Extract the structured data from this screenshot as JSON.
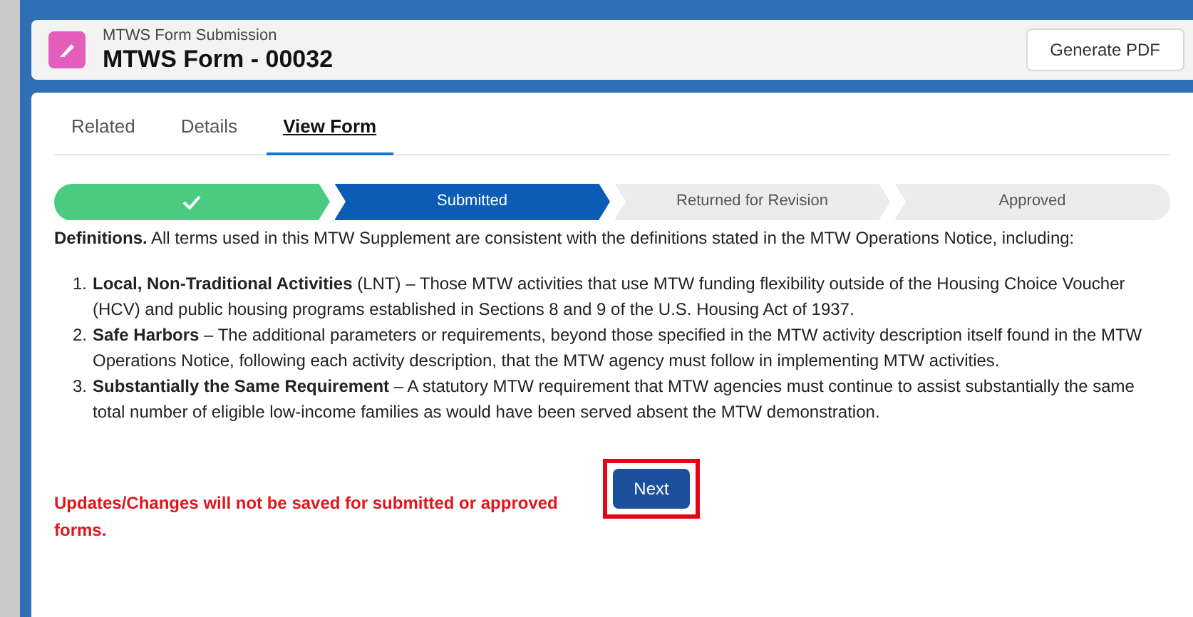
{
  "header": {
    "object_label": "MTWS Form Submission",
    "title": "MTWS Form - 00032",
    "action": "Generate PDF"
  },
  "tabs": [
    {
      "label": "Related",
      "selected": false
    },
    {
      "label": "Details",
      "selected": false
    },
    {
      "label": "View Form",
      "selected": true
    }
  ],
  "path": [
    {
      "kind": "complete"
    },
    {
      "kind": "current",
      "label": "Submitted"
    },
    {
      "kind": "incomplete",
      "label": "Returned for Revision"
    },
    {
      "kind": "incomplete",
      "label": "Approved"
    }
  ],
  "intro": "**Definitions.** All terms used in this MTW Supplement are consistent with the definitions stated in the MTW Operations Notice, including:",
  "definitions": [
    {
      "number": "1.",
      "text": "**Local, Non-Traditional Activities** (LNT) – Those MTW activities that use MTW funding flexibility outside of the Housing Choice Voucher (HCV) and public housing programs established in Sections 8 and 9 of the U.S. Housing Act of 1937."
    },
    {
      "number": "2.",
      "text": "**Safe Harbors** – The additional parameters or requirements, beyond those specified in the MTW activity description itself found in the MTW Operations Notice, following each activity description, that the MTW agency must follow in implementing MTW activities."
    },
    {
      "number": "3.",
      "text": "**Substantially the Same Requirement** – A statutory MTW requirement that MTW agencies must continue to assist substantially the same total number of eligible low-income families as would have been served absent the MTW demonstration."
    }
  ],
  "warning": "Updates/Changes will not be saved for submitted or approved forms.",
  "next_button": {
    "label": "Next",
    "highlighted": true
  }
}
